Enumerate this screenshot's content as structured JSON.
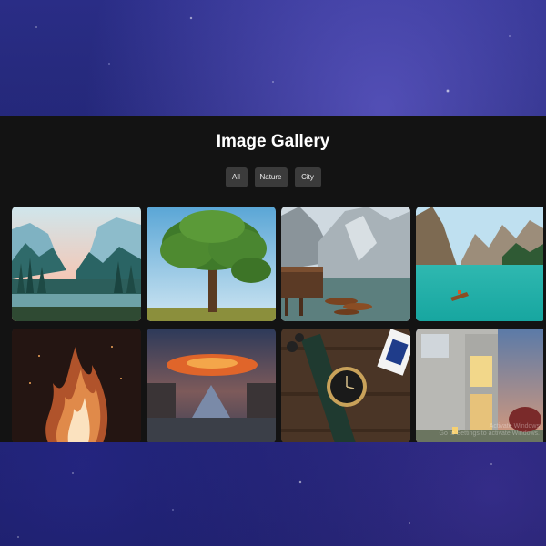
{
  "page": {
    "title": "Image Gallery"
  },
  "filters": [
    {
      "label": "All"
    },
    {
      "label": "Nature"
    },
    {
      "label": "City"
    }
  ],
  "gallery": {
    "images": [
      {
        "name": "mountain-valley-image",
        "category": "Nature"
      },
      {
        "name": "lone-tree-image",
        "category": "Nature"
      },
      {
        "name": "mountain-lake-boats-image",
        "category": "Nature"
      },
      {
        "name": "turquoise-lake-image",
        "category": "Nature"
      },
      {
        "name": "fire-flames-image",
        "category": "Nature"
      },
      {
        "name": "louvre-pyramid-image",
        "category": "City"
      },
      {
        "name": "wristwatch-image",
        "category": "City"
      },
      {
        "name": "modern-house-image",
        "category": "City"
      }
    ],
    "watermark_line1": "Activate Windows",
    "watermark_line2": "Go to Settings to activate Windows."
  },
  "colors": {
    "panel_background": "#131313",
    "button_background": "#3b3b3b",
    "title_text": "#ffffff"
  }
}
